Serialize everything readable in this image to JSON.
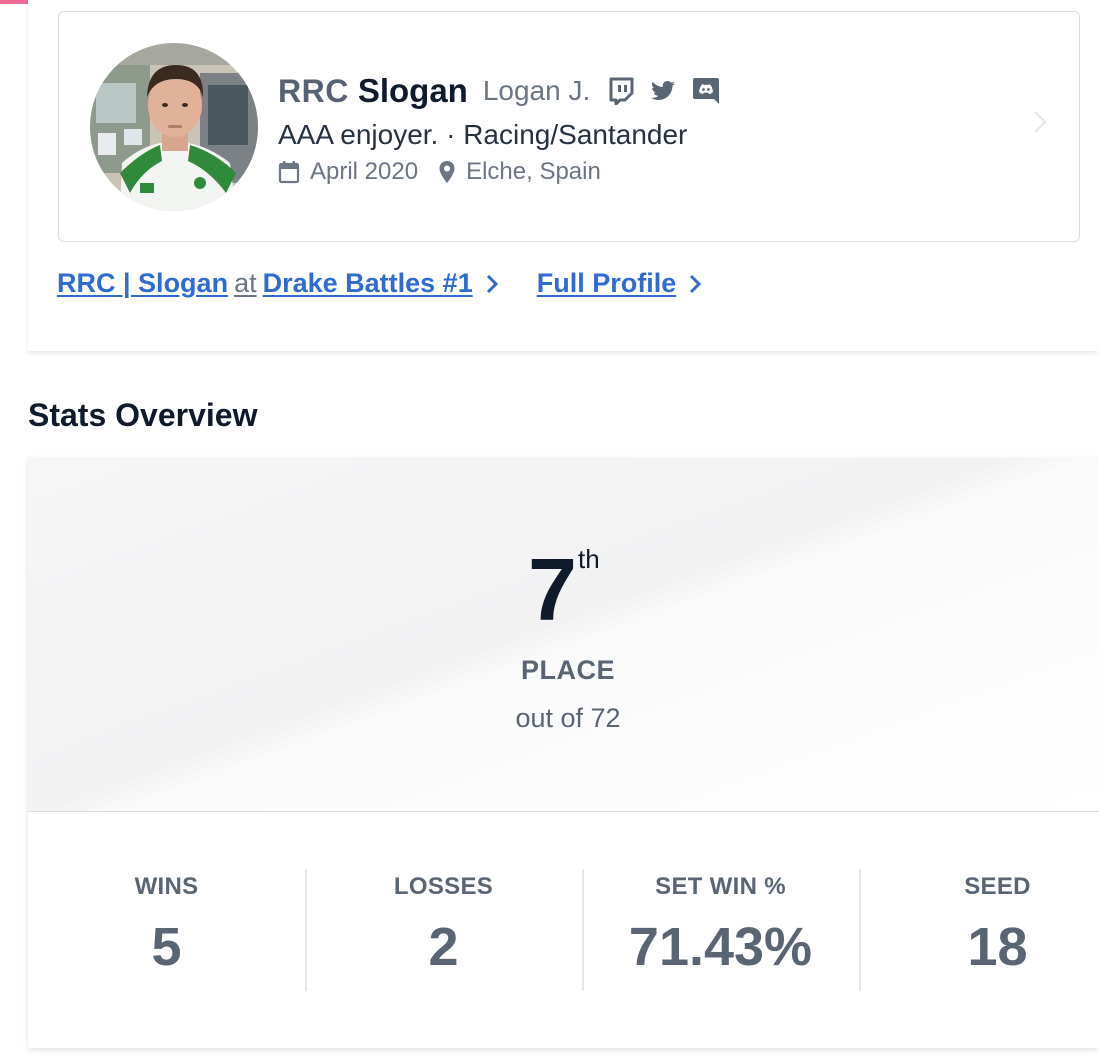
{
  "profile": {
    "prefix": "RRC",
    "gamertag": "Slogan",
    "real_name": "Logan J.",
    "social_icons": [
      "twitch-icon",
      "twitter-icon",
      "discord-icon"
    ],
    "bio": "AAA enjoyer. · Racing/Santander",
    "joined": "April 2020",
    "location": "Elche, Spain"
  },
  "links": {
    "entrant": "RRC | Slogan",
    "at": "at",
    "event": "Drake Battles #1",
    "full_profile": "Full Profile"
  },
  "stats_overview": {
    "title": "Stats Overview",
    "placement": "7",
    "placement_suffix": "th",
    "placement_label": "PLACE",
    "out_of": "out of 72",
    "stats": [
      {
        "label": "WINS",
        "value": "5"
      },
      {
        "label": "LOSSES",
        "value": "2"
      },
      {
        "label": "SET WIN %",
        "value": "71.43%"
      },
      {
        "label": "SEED",
        "value": "18"
      }
    ]
  },
  "colors": {
    "accent_bar": "#ef6a93",
    "link": "#2f6bd0",
    "muted_text": "#5a6574"
  }
}
